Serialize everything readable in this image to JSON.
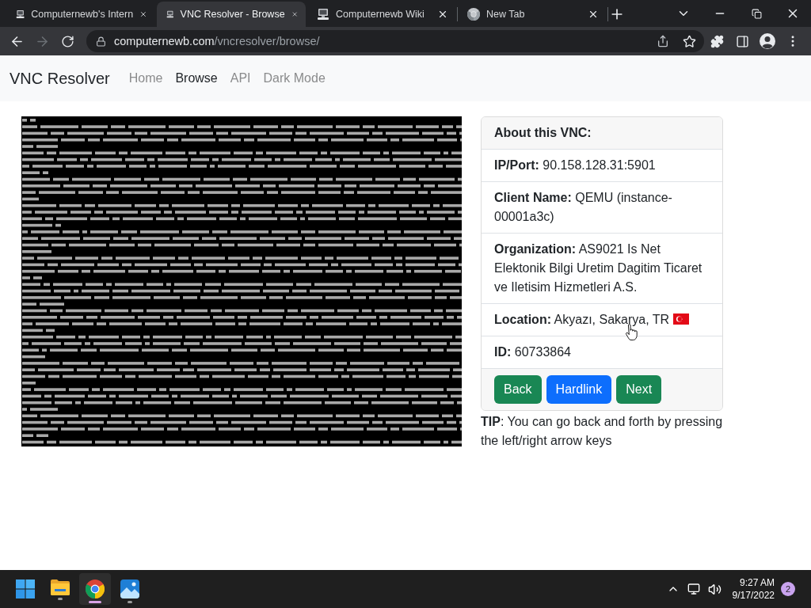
{
  "browser": {
    "tabs": [
      {
        "title": "Computernewb's Intern",
        "selected": false,
        "kind": "site"
      },
      {
        "title": "VNC Resolver - Browse",
        "selected": true,
        "kind": "site"
      },
      {
        "title": "Computernewb Wiki",
        "selected": false,
        "kind": "site"
      },
      {
        "title": "New Tab",
        "selected": false,
        "kind": "newtab"
      }
    ],
    "forward": {
      "disabled": true
    },
    "address": {
      "host": "computernewb.com",
      "path": "/vncresolver/browse/"
    }
  },
  "navbar": {
    "brand": "VNC Resolver",
    "links": [
      {
        "label": "Home",
        "selected": false
      },
      {
        "label": "Browse",
        "selected": true
      },
      {
        "label": "API",
        "selected": false
      },
      {
        "label": "Dark Mode",
        "selected": false
      }
    ]
  },
  "card": {
    "title": "About this VNC:",
    "fields": [
      {
        "label": "IP/Port:",
        "value": "90.158.128.31:5901",
        "flag": false
      },
      {
        "label": "Client Name:",
        "value": "QEMU (instance-00001a3c)",
        "flag": false
      },
      {
        "label": "Organization:",
        "value": "AS9021 Is Net Elektonik Bilgi Uretim Dagitim Ticaret ve Iletisim Hizmetleri A.S.",
        "flag": false
      },
      {
        "label": "Location:",
        "value": "Akyazı, Sakarya, TR",
        "flag": true
      },
      {
        "label": "ID:",
        "value": "60733864",
        "flag": false
      }
    ],
    "buttons": [
      {
        "label": "Back",
        "kind": "success"
      },
      {
        "label": "Hardlink",
        "kind": "primary"
      },
      {
        "label": "Next",
        "kind": "success"
      }
    ]
  },
  "tip": "**TIP**: You can go back and forth by pressing the left/right arrow keys",
  "taskbar": {
    "apps": [
      {
        "kind": "start",
        "running": false,
        "selected": false
      },
      {
        "kind": "files",
        "running": true,
        "selected": false
      },
      {
        "kind": "browser",
        "running": true,
        "selected": true
      },
      {
        "kind": "photos",
        "running": true,
        "selected": false
      }
    ],
    "time": "9:27 AM",
    "date": "9/17/2022",
    "notifications": "2"
  }
}
